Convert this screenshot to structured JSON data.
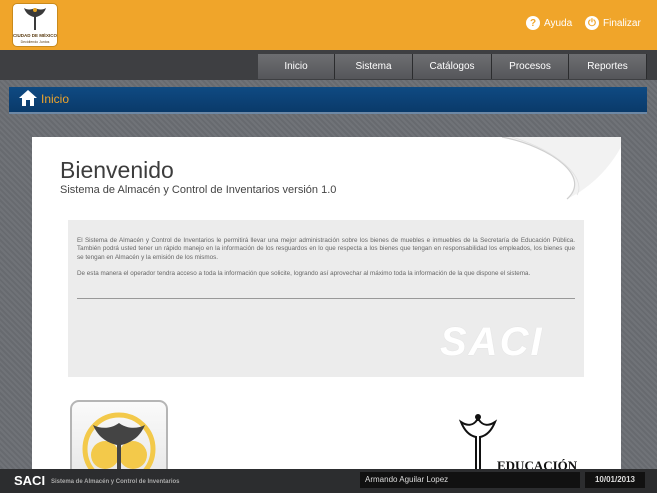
{
  "header": {
    "logo": {
      "line1": "CIUDAD DE MÉXICO",
      "line2": "Decidiendo Juntos",
      "icon": "angel-independencia-icon"
    },
    "help_label": "Ayuda",
    "logout_label": "Finalizar",
    "help_icon": "help-icon",
    "logout_icon": "power-icon"
  },
  "nav": {
    "items": [
      {
        "label": "Inicio"
      },
      {
        "label": "Sistema"
      },
      {
        "label": "Catálogos"
      },
      {
        "label": "Procesos"
      },
      {
        "label": "Reportes"
      }
    ]
  },
  "breadcrumb": {
    "label": "Inicio",
    "icon": "home-icon"
  },
  "main": {
    "title": "Bienvenido",
    "subtitle": "Sistema de Almacén y Control de Inventarios versión 1.0",
    "paragraph1": "El Sistema de Almacén y Control de Inventarios le permitirá llevar una mejor administración sobre los bienes de muebles e inmuebles de la Secretaría de Educación Pública. También podrá usted tener un rápido manejo en la información de los resguardos en lo que respecta a los bienes que tengan en responsabilidad los empleados, los bienes que se tengan en Almacén y la emisión de los mismos.",
    "paragraph2": "De esta manera el operador tendra acceso a toda la información que solicite, logrando así aprovechar al máximo toda la información de la que dispone el sistema.",
    "watermark": "SACI",
    "sep_text": "EDUCACIÓN"
  },
  "footer": {
    "brand": "SACI",
    "subtitle": "Sistema de Almacén y Control de Inventarios",
    "user": "Armando Aguilar Lopez",
    "date": "10/01/2013"
  },
  "colors": {
    "header_orange": "#f0a52a",
    "breadcrumb_blue": "#0f4a82",
    "nav_gray": "#5f6064",
    "footer_dark": "#2c2d2f"
  }
}
